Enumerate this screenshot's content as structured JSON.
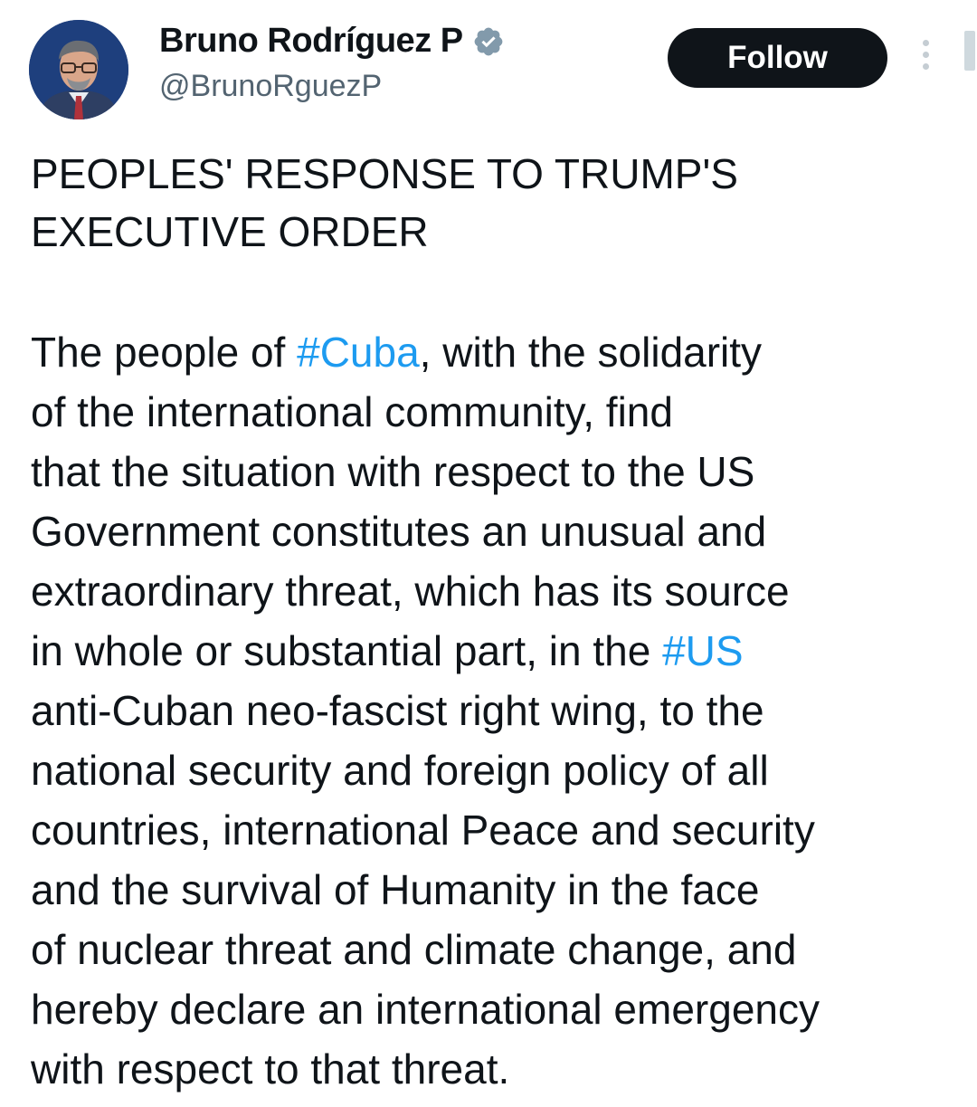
{
  "author": {
    "display_name": "Bruno Rodríguez P",
    "handle": "@BrunoRguezP",
    "verified": true,
    "avatar_icon": "profile-photo"
  },
  "actions": {
    "follow_label": "Follow",
    "more_icon": "vertical-ellipsis-icon"
  },
  "tweet": {
    "title_lines": [
      "PEOPLES' RESPONSE TO TRUMP'S",
      "EXECUTIVE ORDER"
    ],
    "body": {
      "l1_pre": "The people of ",
      "l1_tag": "#Cuba",
      "l1_post": ", with the solidarity",
      "l2": "of the international community, find",
      "l3": "that the situation with respect to the US",
      "l4": "Government constitutes an unusual and",
      "l5": "extraordinary threat, which has its source",
      "l6_pre": "in whole or substantial part, in the ",
      "l6_tag": "#US",
      "l7": "anti-Cuban neo-fascist right wing, to the",
      "l8": "national security and foreign policy of all",
      "l9": "countries, international Peace and security",
      "l10": "and the survival of Humanity in the face",
      "l11": "of nuclear threat and climate change, and",
      "l12": "hereby declare an international emergency",
      "l13": "with respect to that threat."
    }
  },
  "colors": {
    "text": "#0f1419",
    "secondary": "#536471",
    "link": "#1d9bf0",
    "verified_badge": "#829aab",
    "button_bg": "#0f1419"
  }
}
